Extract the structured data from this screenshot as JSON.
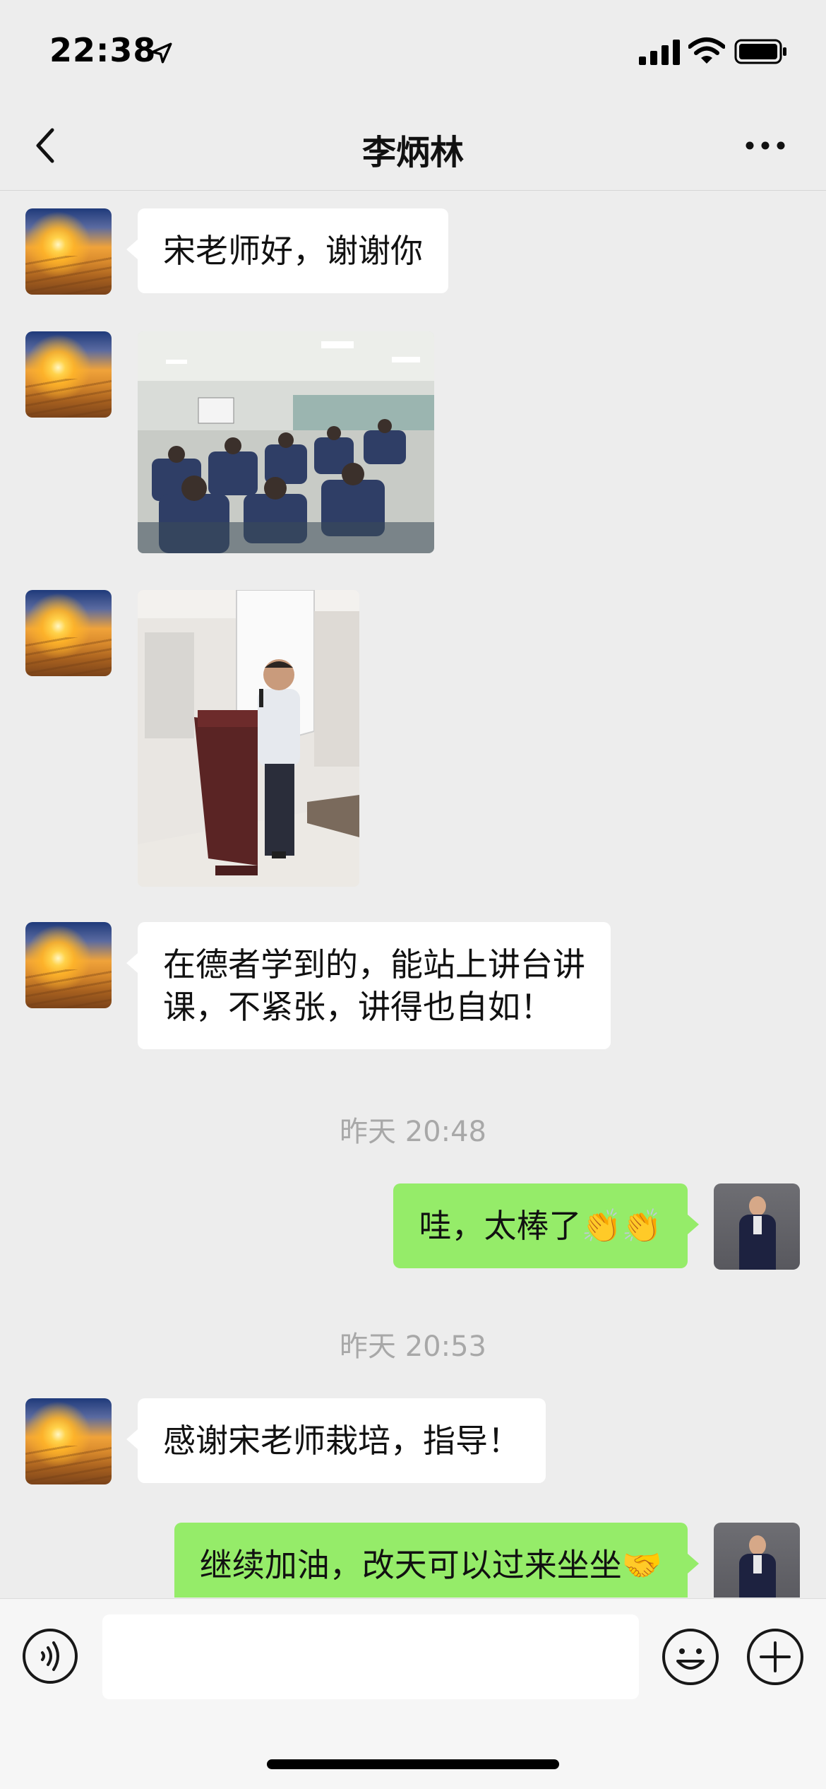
{
  "status_bar": {
    "time": "22:38"
  },
  "nav": {
    "title": "李炳林"
  },
  "messages": [
    {
      "side": "left",
      "type": "text",
      "text": "宋老师好，谢谢你"
    },
    {
      "side": "left",
      "type": "image",
      "description_icon": "classroom-photo"
    },
    {
      "side": "left",
      "type": "image",
      "description_icon": "lecture-podium-photo"
    },
    {
      "side": "left",
      "type": "text",
      "lines": [
        "在德者学到的，能站上讲台讲",
        "课，不紧张，讲得也自如！"
      ]
    },
    {
      "type": "timestamp",
      "text": "昨天 20:48"
    },
    {
      "side": "right",
      "type": "text",
      "text": "哇，太棒了👏👏"
    },
    {
      "type": "timestamp",
      "text": "昨天 20:53"
    },
    {
      "side": "left",
      "type": "text",
      "text": "感谢宋老师栽培，指导！"
    },
    {
      "side": "right",
      "type": "text",
      "text": "继续加油，改天可以过来坐坐🤝"
    }
  ],
  "colors": {
    "background": "#ededed",
    "bubble_left": "#ffffff",
    "bubble_right": "#95ec69",
    "timestamp": "#a8a8a8"
  },
  "icons": {
    "location": "location-arrow-icon",
    "signal": "cellular-signal-icon",
    "wifi": "wifi-icon",
    "battery": "battery-icon",
    "back": "back-chevron-icon",
    "more": "more-dots-icon",
    "voice": "voice-icon",
    "emoji": "emoji-icon",
    "plus": "plus-icon"
  }
}
